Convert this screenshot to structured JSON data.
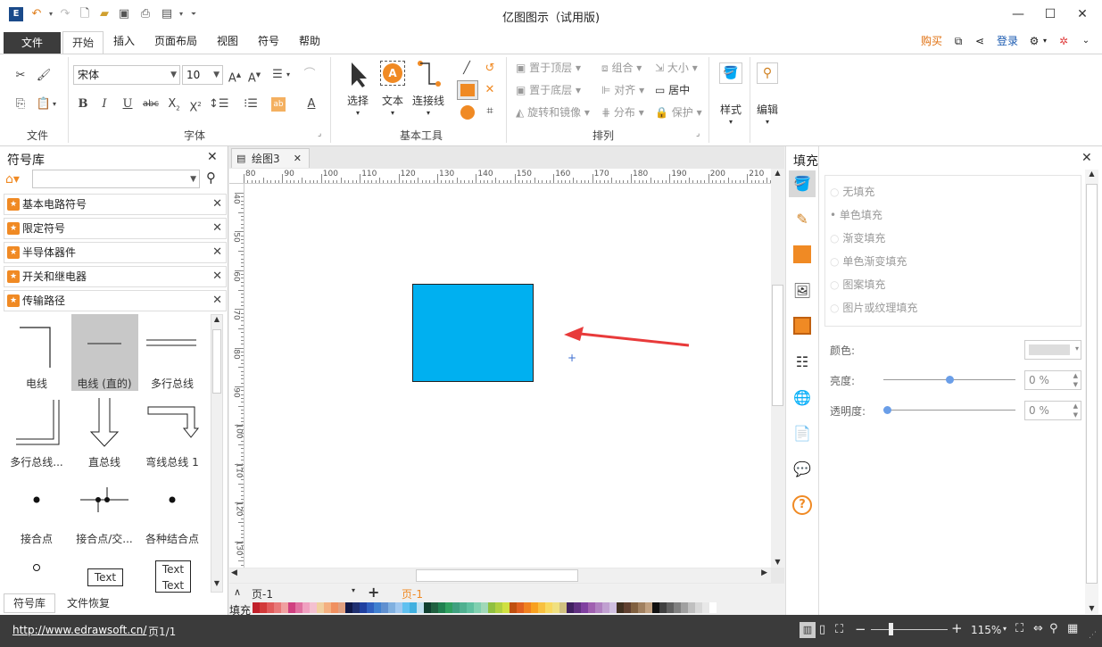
{
  "app": {
    "title": "亿图图示（试用版)"
  },
  "menu": {
    "file": "文件",
    "items": [
      "开始",
      "插入",
      "页面布局",
      "视图",
      "符号",
      "帮助"
    ],
    "right": {
      "buy": "购买",
      "login": "登录"
    }
  },
  "ribbon": {
    "font_name": "宋体",
    "font_size": "10",
    "groups": {
      "file": "文件",
      "font": "字体",
      "tools": "基本工具",
      "arrange": "排列"
    },
    "tools": {
      "select": "选择",
      "text": "文本",
      "connector": "连接线"
    },
    "arrange": {
      "bring_front": "置于顶层",
      "send_back": "置于底层",
      "rotate": "旋转和镜像",
      "group": "组合",
      "align": "对齐",
      "distribute": "分布",
      "size": "大小",
      "center": "居中",
      "protect": "保护"
    },
    "style": "样式",
    "edit": "编辑"
  },
  "library": {
    "title": "符号库",
    "sections": [
      "基本电路符号",
      "限定符号",
      "半导体器件",
      "开关和继电器",
      "传输路径"
    ],
    "shapes": [
      "电线",
      "电线 (直的)",
      "多行总线",
      "多行总线...",
      "直总线",
      "弯线总线 1",
      "接合点",
      "接合点/交...",
      "各种结合点"
    ],
    "text_shapes": [
      "Text",
      "Text",
      "Text"
    ],
    "bottom_tabs": [
      "符号库",
      "文件恢复"
    ]
  },
  "document": {
    "tab": "绘图3",
    "page_select": "页-1",
    "page_tab": "页-1",
    "fill_label": "填充"
  },
  "rulers": {
    "h": [
      "80",
      "90",
      "100",
      "110",
      "120",
      "130",
      "140",
      "150",
      "160",
      "170",
      "180",
      "190",
      "200",
      "210"
    ],
    "v": [
      "40",
      "50",
      "60",
      "70",
      "80",
      "90",
      "100",
      "110",
      "120",
      "130"
    ]
  },
  "fill": {
    "title": "填充",
    "options": [
      "无填充",
      "单色填充",
      "渐变填充",
      "单色渐变填充",
      "图案填充",
      "图片或纹理填充"
    ],
    "selected_option": "单色填充",
    "color_label": "颜色:",
    "brightness_label": "亮度:",
    "brightness_value": "0 %",
    "transparency_label": "透明度:",
    "transparency_value": "0 %",
    "brightness_level": 0.5,
    "transparency_level": 0.0
  },
  "status": {
    "url": "http://www.edrawsoft.cn/",
    "page": "页1/1",
    "zoom": "115%"
  },
  "colors": {
    "accent": "#f08a24",
    "shape_fill": "#00b0f0",
    "arrow": "#e83a3a"
  },
  "palette": [
    "#c0202a",
    "#d23a3a",
    "#e05a5a",
    "#e87878",
    "#f0a0a0",
    "#d04080",
    "#e070a0",
    "#f0a0c0",
    "#f4c0d0",
    "#f0d0a0",
    "#f4b080",
    "#f09060",
    "#e0a080",
    "#101848",
    "#203070",
    "#2040a0",
    "#3060c0",
    "#4080d0",
    "#6090d0",
    "#80b0e0",
    "#a0c8f0",
    "#60c0f0",
    "#40b0e0",
    "#c0e0f0",
    "#104030",
    "#206040",
    "#208050",
    "#30a060",
    "#40a080",
    "#50b090",
    "#60c0a0",
    "#80d0b0",
    "#a0d8b8",
    "#90c040",
    "#b0d040",
    "#d0e040",
    "#c05010",
    "#e06020",
    "#f08020",
    "#f8a020",
    "#f8c040",
    "#f8d860",
    "#f0e080",
    "#d0c080",
    "#402060",
    "#603080",
    "#8040a0",
    "#a060b0",
    "#b080c0",
    "#c0a0d0",
    "#d0c0e0",
    "#403020",
    "#604030",
    "#806040",
    "#a08060",
    "#c0a080",
    "#101010",
    "#404040",
    "#606060",
    "#808080",
    "#a0a0a0",
    "#c0c0c0",
    "#d8d8d8",
    "#e8e8e8",
    "#ffffff"
  ]
}
